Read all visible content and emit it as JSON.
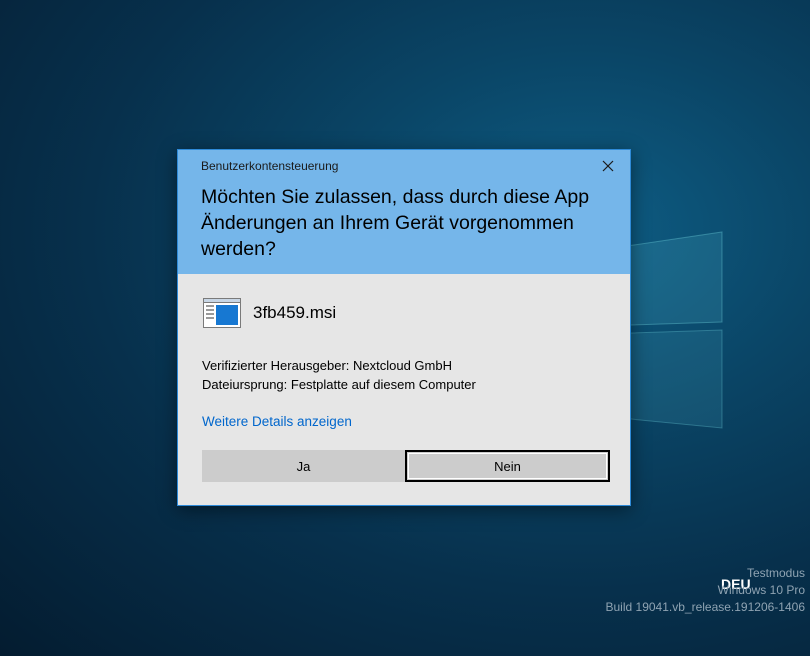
{
  "dialog": {
    "title": "Benutzerkontensteuerung",
    "question": "Möchten Sie zulassen, dass durch diese App Änderungen an Ihrem Gerät vorgenommen werden?",
    "app_name": "3fb459.msi",
    "publisher": "Verifizierter Herausgeber: Nextcloud GmbH",
    "origin": "Dateiursprung: Festplatte auf diesem Computer",
    "details_link": "Weitere Details anzeigen",
    "yes_label": "Ja",
    "no_label": "Nein",
    "close_icon": "close-icon",
    "app_icon": "msi-installer-icon"
  },
  "desktop": {
    "language": "DEU",
    "watermark": {
      "line1": "Testmodus",
      "line2": "Windows 10 Pro",
      "line3": "Build 19041.vb_release.191206-1406"
    }
  },
  "colors": {
    "header": "#75b6ea",
    "body": "#e6e6e6",
    "link": "#0066cc",
    "button": "#cccccc"
  }
}
